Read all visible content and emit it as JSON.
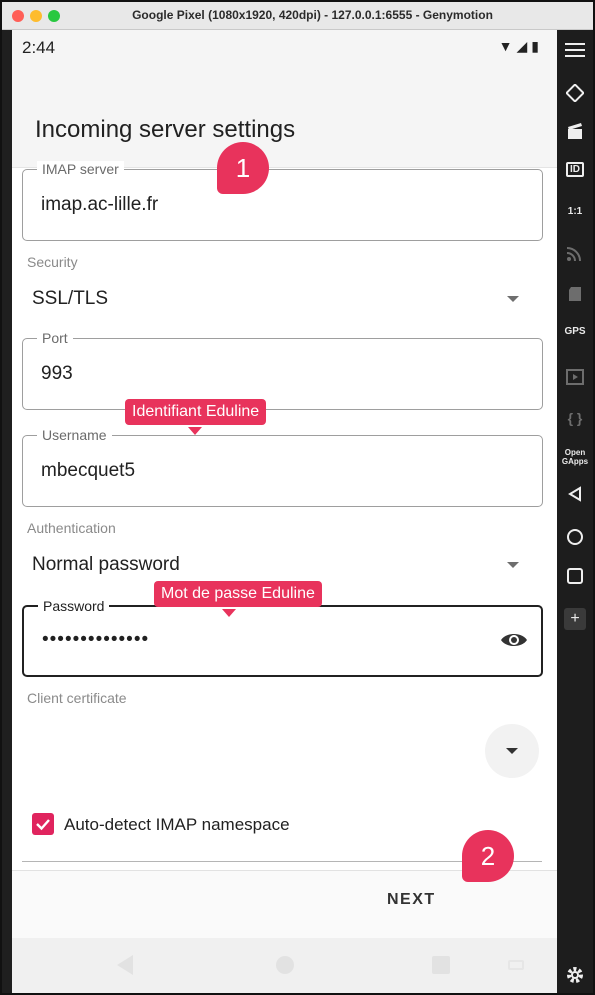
{
  "window": {
    "title": "Google Pixel (1080x1920, 420dpi) - 127.0.0.1:6555 - Genymotion"
  },
  "status_bar": {
    "time": "2:44",
    "icons": [
      "wifi-icon",
      "signal-icon",
      "battery-icon"
    ]
  },
  "screen": {
    "title": "Incoming server settings"
  },
  "form": {
    "imap_server": {
      "label": "IMAP server",
      "value": "imap.ac-lille.fr"
    },
    "security": {
      "label": "Security",
      "value": "SSL/TLS"
    },
    "port": {
      "label": "Port",
      "value": "993"
    },
    "username": {
      "label": "Username",
      "value": "mbecquet5"
    },
    "authentication": {
      "label": "Authentication",
      "value": "Normal password"
    },
    "password": {
      "label": "Password",
      "value": "••••••••••••••"
    },
    "client_certificate": {
      "label": "Client certificate",
      "value": ""
    },
    "auto_detect": {
      "label": "Auto-detect IMAP namespace",
      "checked": true
    }
  },
  "actions": {
    "next_label": "NEXT"
  },
  "annotations": {
    "step1": "1",
    "step2": "2",
    "username_note": "Identifiant Eduline",
    "password_note": "Mot de passe Eduline"
  },
  "toolbar": {
    "id_label": "ID",
    "scale_label": "1:1",
    "gps_label": "GPS",
    "opengapps_label": "Open GApps",
    "code_label": "{ }",
    "plus_label": "+"
  },
  "colors": {
    "accent": "#e0245e",
    "annotation": "#e8335c",
    "toolbar_bg": "#1d1d1d"
  }
}
